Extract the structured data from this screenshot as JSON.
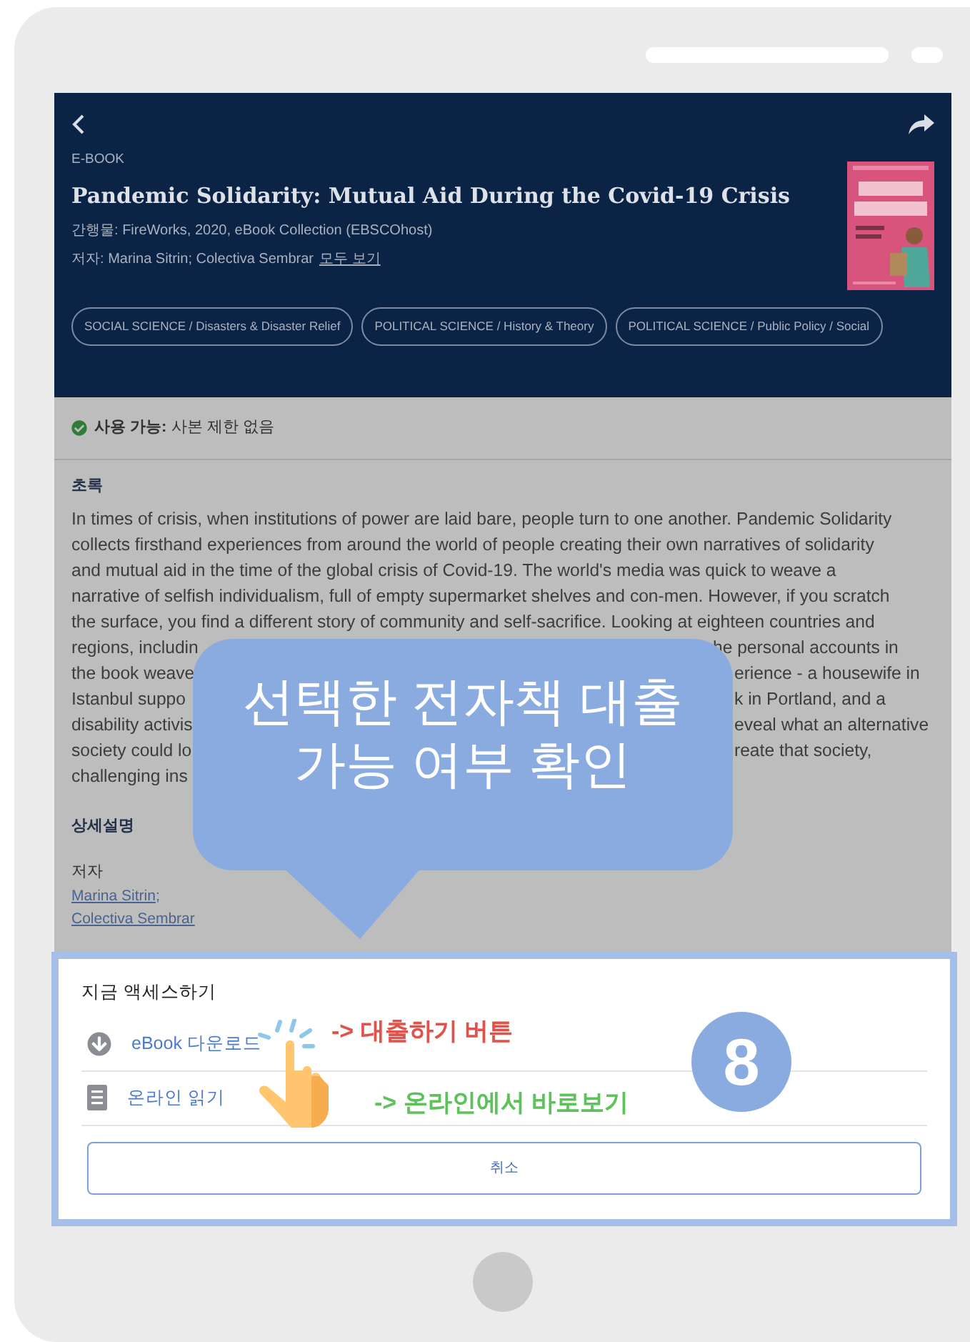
{
  "header": {
    "type_label": "E-BOOK",
    "title": "Pandemic Solidarity: Mutual Aid During the Covid-19 Crisis",
    "publisher_label": "간행물:",
    "publisher": "FireWorks, 2020, eBook Collection (EBSCOhost)",
    "author_label": "저자:",
    "authors": "Marina Sitrin; Colectiva Sembrar",
    "see_all": "모두 보기",
    "subjects": [
      "SOCIAL SCIENCE / Disasters & Disaster Relief",
      "POLITICAL SCIENCE / History & Theory",
      "POLITICAL SCIENCE / Public Policy / Social"
    ]
  },
  "availability": {
    "label": "사용 가능:",
    "value": "사본 제한 없음"
  },
  "abstract": {
    "heading": "초록",
    "lines": [
      "In times of crisis, when institutions of power are laid bare, people turn to one another. Pandemic Solidarity",
      "collects firsthand experiences from around the world of people creating their own narratives of solidarity",
      "and mutual aid in the time of the global crisis of Covid-19. The world's media was quick to weave a",
      "narrative of selfish individualism, full of empty supermarket shelves and con-men. However, if you scratch",
      "the surface, you find a different story of community and self-sacrifice. Looking at eighteen countries and"
    ],
    "covered_lines": [
      {
        "left": "regions, includin",
        "right": "he personal accounts in"
      },
      {
        "left": "the book weave",
        "right": "erience - a housewife in"
      },
      {
        "left": "Istanbul suppo",
        "right": "k in Portland, and a"
      },
      {
        "left": "disability activis",
        "right": "eveal what an alternative"
      },
      {
        "left": "society could lo",
        "right": "reate that society,"
      },
      {
        "left": "challenging ins"
      }
    ]
  },
  "details": {
    "heading": "상세설명",
    "author_heading": "저자",
    "authors": [
      "Marina Sitrin",
      "Colectiva Sembrar"
    ],
    "separator": ";"
  },
  "sheet": {
    "title": "지금 액세스하기",
    "options": [
      {
        "kind": "download",
        "label": "eBook 다운로드"
      },
      {
        "kind": "read",
        "label": "온라인 읽기"
      }
    ],
    "cancel": "취소"
  },
  "annotation": {
    "callout_lines": [
      "선택한 전자책 대출",
      "가능 여부 확인"
    ],
    "step": "8",
    "notes": [
      {
        "text": "-> 대출하기 버튼",
        "color": "#e0534b"
      },
      {
        "text": "-> 온라인에서 바로보기",
        "color": "#5dc25a"
      }
    ]
  }
}
